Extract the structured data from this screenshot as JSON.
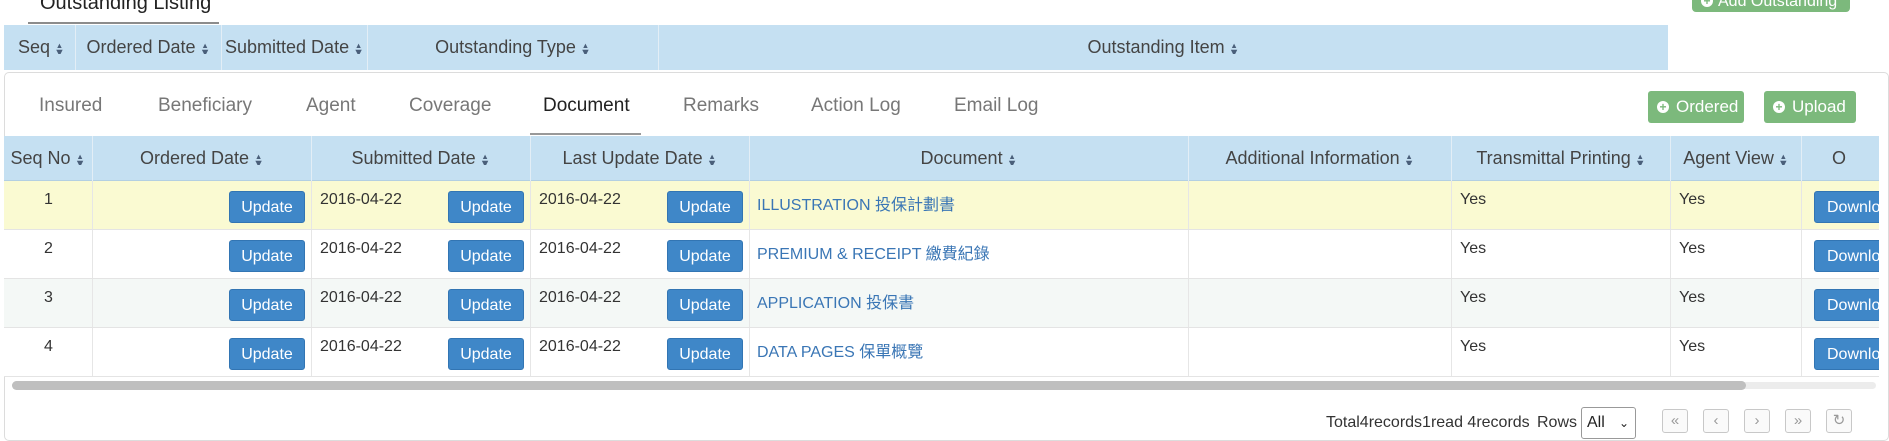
{
  "top": {
    "title": "Outstanding Listing",
    "add_button": "Add Outstanding"
  },
  "outer_table": {
    "columns": [
      "Seq",
      "Ordered Date",
      "Submitted Date",
      "Outstanding Type",
      "Outstanding Item"
    ]
  },
  "tabs": [
    {
      "label": "Insured"
    },
    {
      "label": "Beneficiary"
    },
    {
      "label": "Agent"
    },
    {
      "label": "Coverage"
    },
    {
      "label": "Document",
      "active": true
    },
    {
      "label": "Remarks"
    },
    {
      "label": "Action Log"
    },
    {
      "label": "Email Log"
    }
  ],
  "actions": {
    "ordered": "Ordered",
    "upload": "Upload"
  },
  "doc_table": {
    "columns": [
      "Seq No",
      "Ordered Date",
      "Submitted Date",
      "Last Update Date",
      "Document",
      "Additional Information",
      "Transmittal Printing",
      "Agent View",
      "O"
    ],
    "update_label": "Update",
    "download_label": "Download",
    "rows": [
      {
        "seq": "1",
        "submitted": "2016-04-22",
        "last_update": "2016-04-22",
        "document": "ILLUSTRATION 投保計劃書",
        "transmittal": "Yes",
        "agent_view": "Yes"
      },
      {
        "seq": "2",
        "submitted": "2016-04-22",
        "last_update": "2016-04-22",
        "document": "PREMIUM & RECEIPT 繳費紀錄",
        "transmittal": "Yes",
        "agent_view": "Yes"
      },
      {
        "seq": "3",
        "submitted": "2016-04-22",
        "last_update": "2016-04-22",
        "document": "APPLICATION 投保書",
        "transmittal": "Yes",
        "agent_view": "Yes"
      },
      {
        "seq": "4",
        "submitted": "2016-04-22",
        "last_update": "2016-04-22",
        "document": "DATA PAGES 保單概覽",
        "transmittal": "Yes",
        "agent_view": "Yes"
      }
    ]
  },
  "footer": {
    "summary": "Total4records1read 4records",
    "rows_label": "Rows",
    "rows_value": "All"
  },
  "colors": {
    "header_bg": "#c5e0f2",
    "selected_row": "#fafad2",
    "stripe_row": "#f4f8f6",
    "blue_button": "#3f87c8",
    "green_button": "#7cb97c",
    "link": "#3a76b5"
  }
}
